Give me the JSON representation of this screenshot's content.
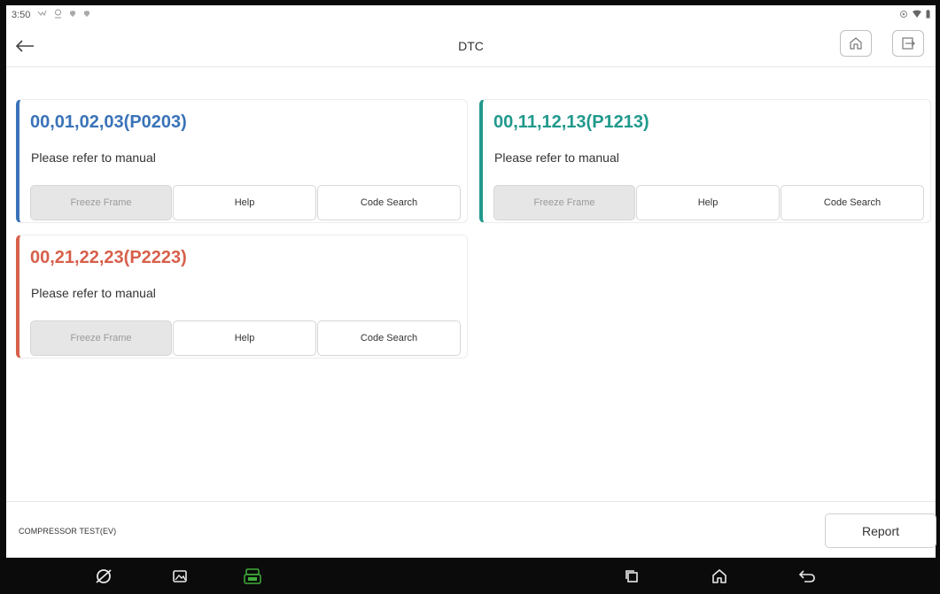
{
  "status_bar": {
    "time": "3:50"
  },
  "header": {
    "title": "DTC"
  },
  "dtcs": [
    {
      "code": "00,01,02,03(P0203)",
      "description": "Please refer to manual",
      "accent": "#3a73b8",
      "buttons": {
        "freeze": "Freeze Frame",
        "help": "Help",
        "search": "Code Search"
      }
    },
    {
      "code": "00,11,12,13(P1213)",
      "description": "Please refer to manual",
      "accent": "#21998d",
      "buttons": {
        "freeze": "Freeze Frame",
        "help": "Help",
        "search": "Code Search"
      }
    },
    {
      "code": "00,21,22,23(P2223)",
      "description": "Please refer to manual",
      "accent": "#d7604b",
      "buttons": {
        "freeze": "Freeze Frame",
        "help": "Help",
        "search": "Code Search"
      }
    }
  ],
  "footer": {
    "test_name": "COMPRESSOR TEST(EV)",
    "report_label": "Report"
  },
  "icons": {
    "back": "arrow-left-icon",
    "home": "home-icon",
    "exit": "exit-icon",
    "nav_browser": "browser-icon",
    "nav_gallery": "gallery-icon",
    "nav_vci": "vci-icon",
    "nav_recents": "recents-icon",
    "nav_home": "home-icon",
    "nav_back": "back-icon"
  },
  "colors": {
    "vci_green": "#3fae3a"
  }
}
